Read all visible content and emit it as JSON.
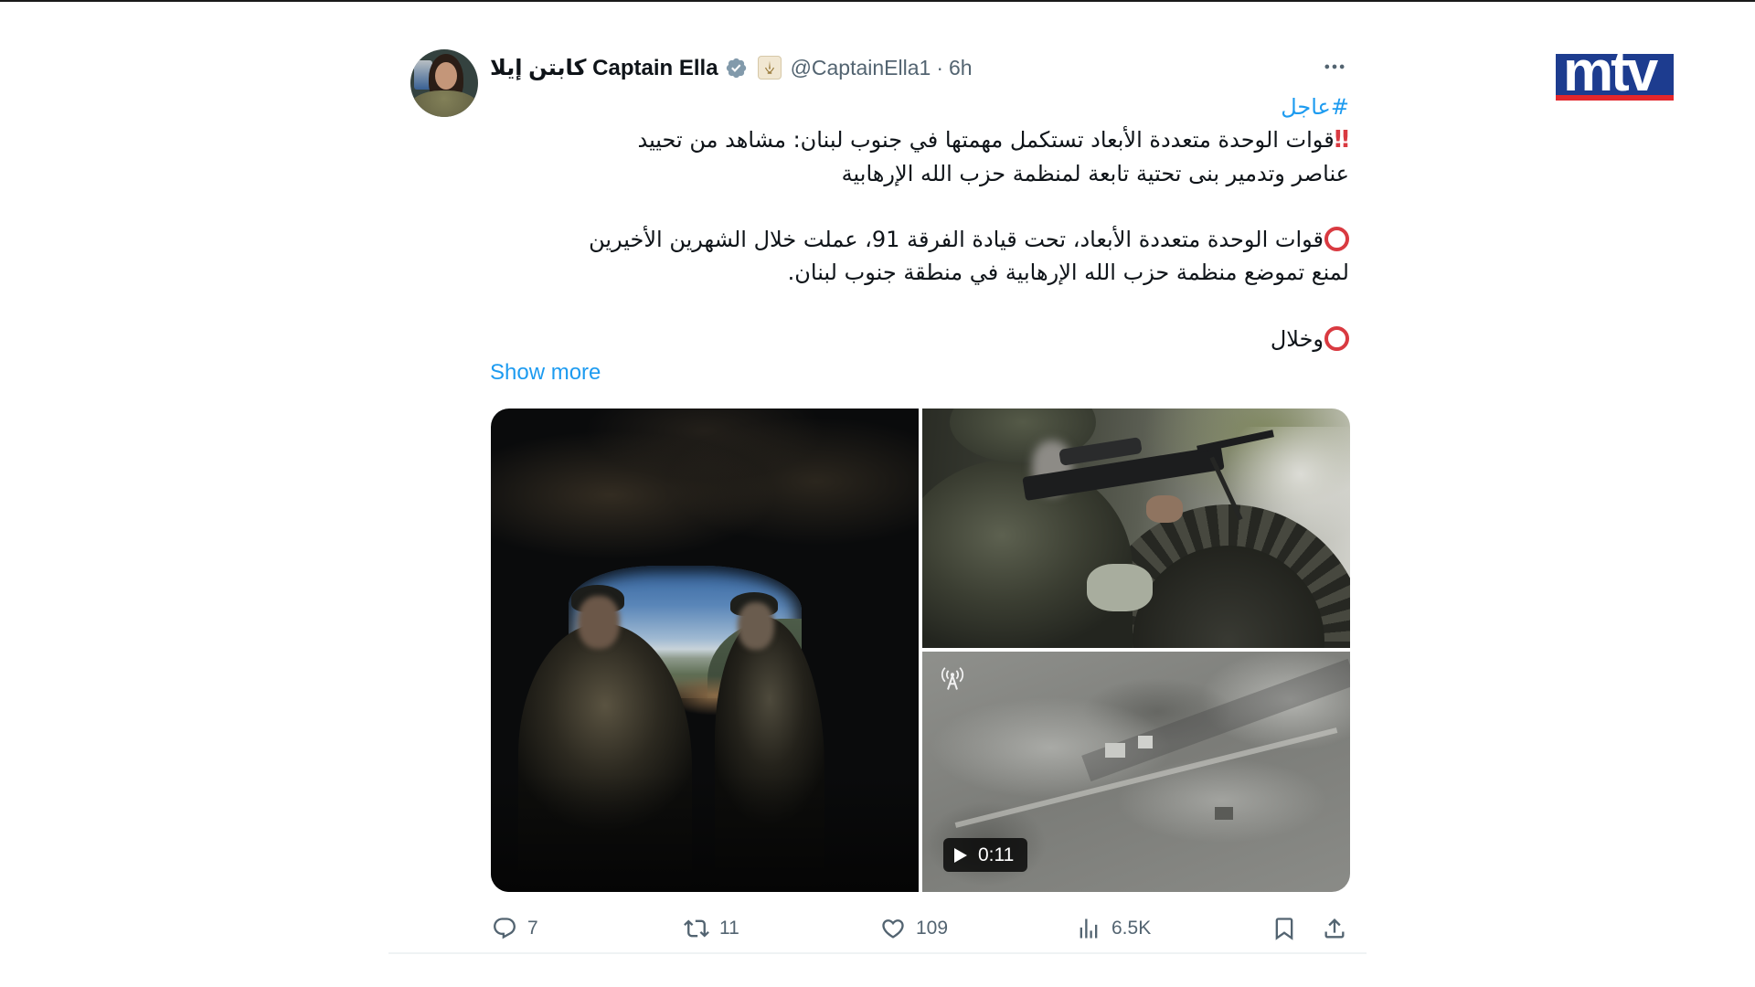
{
  "colors": {
    "text": "#0f1419",
    "secondary": "#536471",
    "accent": "#1d9bf0",
    "marker_red": "#d93a41",
    "verified_gray": "#829aab",
    "brand_blue": "#1d3c8f",
    "brand_red": "#e3262b"
  },
  "brand": {
    "logo_text": "mtv"
  },
  "tweet": {
    "author": {
      "display_name": "كابتن إيلا Captain Ella",
      "verified_icon": "verified-badge-icon",
      "affiliation_icon": "affiliate-badge-icon",
      "handle": "@CaptainElla1",
      "separator": "·",
      "timestamp": "6h"
    },
    "more_icon": "more-horizontal-icon",
    "hashtag": "#عاجل",
    "paragraphs": [
      {
        "marker": "‼",
        "lines": [
          "قوات الوحدة متعددة الأبعاد تستكمل مهمتها في جنوب لبنان: مشاهد من تحييد",
          "عناصر وتدمير بنى تحتية تابعة لمنظمة حزب الله الإرهابية"
        ]
      },
      {
        "marker_icon": "heavy-large-circle-icon",
        "lines": [
          "قوات الوحدة متعددة الأبعاد، تحت قيادة الفرقة 91، عملت خلال الشهرين الأخيرين",
          "لمنع تموضع منظمة حزب الله الإرهابية في منطقة جنوب لبنان."
        ]
      },
      {
        "marker_icon": "heavy-large-circle-icon",
        "lines": [
          "وخلال"
        ]
      }
    ],
    "show_more": "Show more",
    "media": {
      "video": {
        "duration": "0:11",
        "play_icon": "play-icon",
        "overlay_icon": "antenna-icon"
      }
    },
    "actions": {
      "reply": {
        "icon": "reply-icon",
        "count": "7"
      },
      "retweet": {
        "icon": "retweet-icon",
        "count": "11"
      },
      "like": {
        "icon": "like-icon",
        "count": "109"
      },
      "views": {
        "icon": "views-icon",
        "count": "6.5K"
      },
      "bookmark": {
        "icon": "bookmark-icon"
      },
      "share": {
        "icon": "share-icon"
      }
    }
  }
}
